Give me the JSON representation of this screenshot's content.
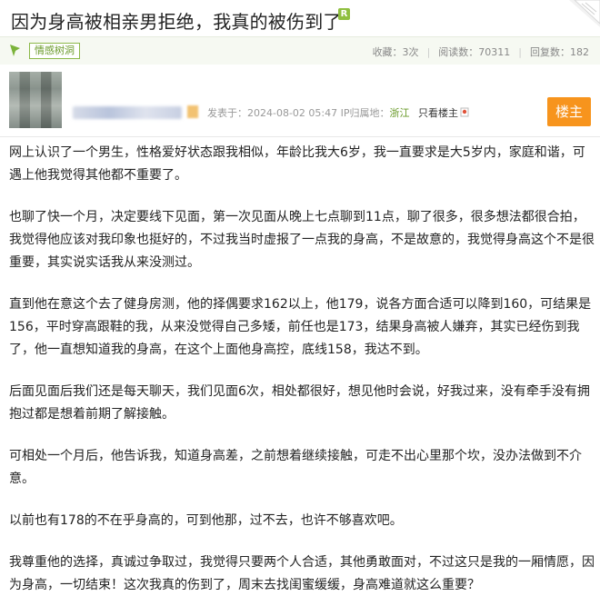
{
  "header": {
    "title": "因为身高被相亲男拒绝，我真的被伤到了",
    "badge": "R"
  },
  "info_bar": {
    "tag": "情感树洞",
    "stats": {
      "favorites": "收藏：3次",
      "reads": "阅读数：70311",
      "replies": "回复数：182"
    }
  },
  "author": {
    "post_time": "发表于：2024-08-02 05:47",
    "ip_label": "IP归属地：",
    "ip_location": "浙江",
    "only_op": "只看楼主",
    "op_button": "楼主"
  },
  "post": {
    "paragraphs": [
      "网上认识了一个男生，性格爱好状态跟我相似，年龄比我大6岁，我一直要求是大5岁内，家庭和谐，可遇上他我觉得其他都不重要了。",
      "也聊了快一个月，决定要线下见面，第一次见面从晚上七点聊到11点，聊了很多，很多想法都很合拍，我觉得他应该对我印象也挺好的，不过我当时虚报了一点我的身高，不是故意的，我觉得身高这个不是很重要，其实说实话我从来没测过。",
      "直到他在意这个去了健身房测，他的择偶要求162以上，他179，说各方面合适可以降到160，可结果是156，平时穿高跟鞋的我，从来没觉得自己多矮，前任也是173，结果身高被人嫌弃，其实已经伤到我了，他一直想知道我的身高，在这个上面他身高控，底线158，我达不到。",
      "后面见面后我们还是每天聊天，我们见面6次，相处都很好，想见他时会说，好我过来，没有牵手没有拥抱过都是想着前期了解接触。",
      "可相处一个月后，他告诉我，知道身高差，之前想着继续接触，可走不出心里那个坎，没办法做到不介意。",
      "以前也有178的不在乎身高的，可到他那，过不去，也许不够喜欢吧。",
      "我尊重他的选择，真诚过争取过，我觉得只要两个人合适，其他勇敢面对，不过这只是我的一厢情愿，因为身高，一切结束！这次我真的伤到了，周末去找闺蜜缓缓，身高难道就这么重要？"
    ]
  },
  "colors": {
    "accent_green": "#8cb84a",
    "op_orange": "#f7941d"
  }
}
